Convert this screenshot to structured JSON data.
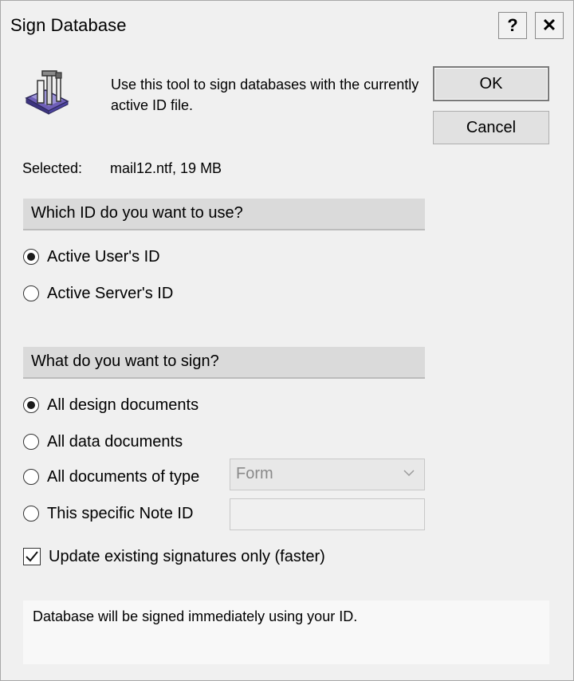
{
  "window": {
    "title": "Sign Database"
  },
  "titlebar": {
    "help_glyph": "?",
    "close_glyph": "✕"
  },
  "intro": {
    "text": "Use this tool to sign databases with the currently active ID file.",
    "icon": "sign-database-icon"
  },
  "buttons": {
    "ok": "OK",
    "cancel": "Cancel"
  },
  "selected": {
    "label": "Selected:",
    "value": "mail12.ntf, 19 MB"
  },
  "id_section": {
    "heading": "Which ID do you want to use?",
    "options": [
      {
        "label": "Active User's ID",
        "checked": true
      },
      {
        "label": "Active Server's ID",
        "checked": false
      }
    ]
  },
  "sign_section": {
    "heading": "What do you want to sign?",
    "options": [
      {
        "label": "All design documents",
        "checked": true
      },
      {
        "label": "All data documents",
        "checked": false
      },
      {
        "label": "All documents of type",
        "checked": false
      },
      {
        "label": "This specific Note ID",
        "checked": false
      }
    ],
    "doc_type": {
      "value": "Form",
      "disabled": true
    },
    "note_id": {
      "value": ""
    }
  },
  "update_only": {
    "label": "Update existing signatures only (faster)",
    "checked": true
  },
  "status": {
    "text": "Database will be signed immediately using your ID."
  }
}
